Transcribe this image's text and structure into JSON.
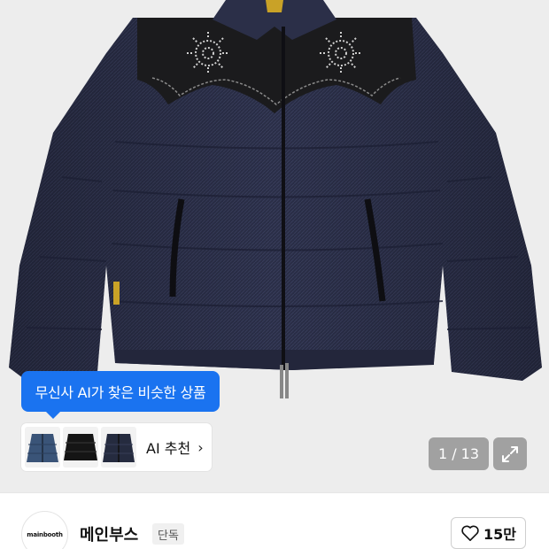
{
  "product_image": {
    "ai_tooltip": "무신사 AI가 찾은 비슷한 상품",
    "ai_recommend": {
      "label": "AI 추천",
      "chevron": "›",
      "thumbnails": [
        "denim-puffer-thumb",
        "black-puffer-thumb",
        "navy-puffer-thumb"
      ]
    },
    "counter": "1 / 13",
    "expand_icon": "expand-arrows-icon"
  },
  "brand": {
    "logo_text": "mainbooth",
    "name": "메인부스",
    "badge": "단독",
    "like_icon": "heart-icon",
    "like_count": "15만"
  },
  "colors": {
    "accent": "#1a73f0",
    "jacket_denim": "#2a2e45",
    "leather_yoke": "#1b1b1d"
  }
}
